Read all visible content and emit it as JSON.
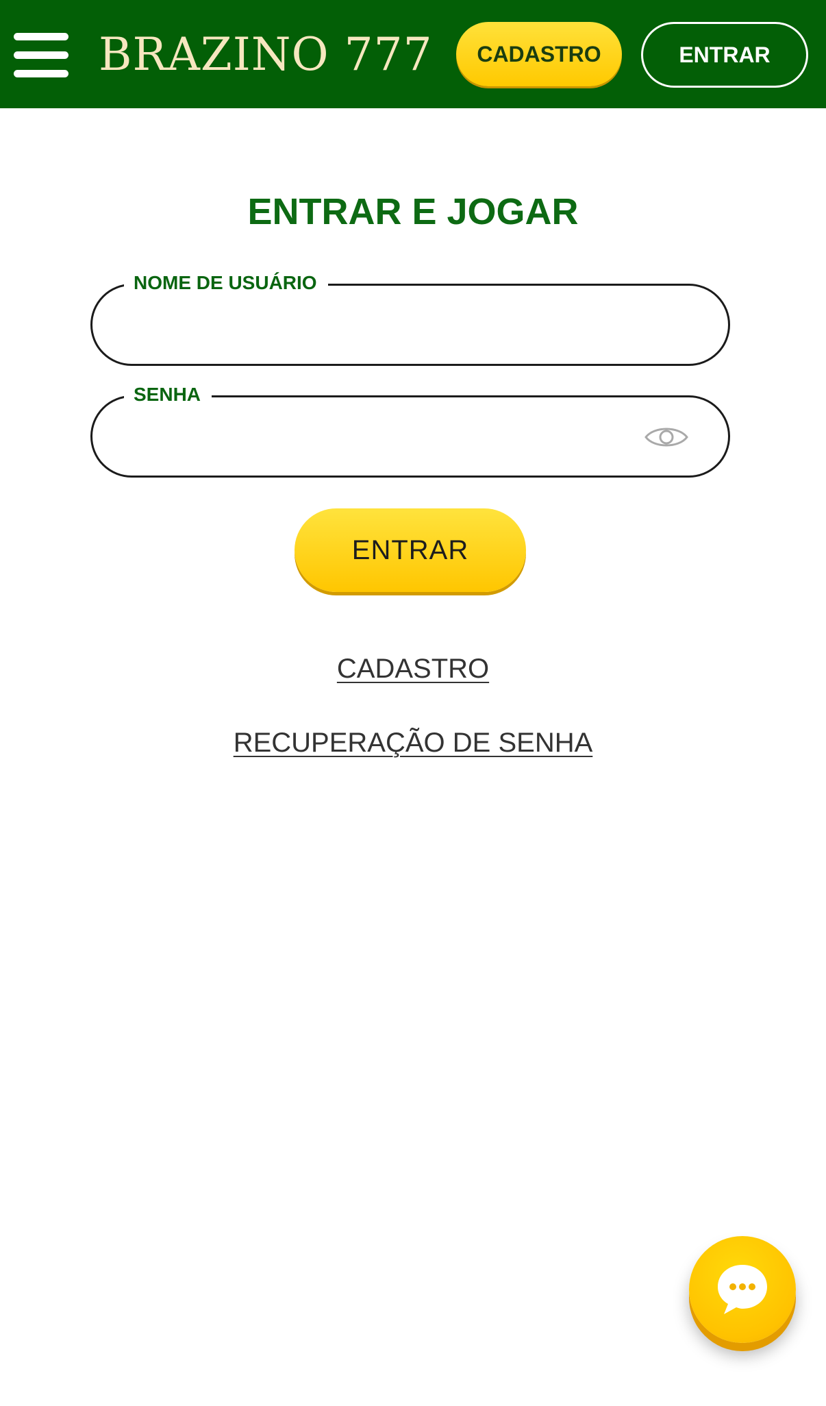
{
  "header": {
    "logo_text": "BRAZINO 777",
    "menu_icon": "hamburger-menu-icon",
    "cadastro_label": "CADASTRO",
    "entrar_label": "ENTRAR"
  },
  "login": {
    "title": "ENTRAR E JOGAR",
    "username": {
      "label": "NOME DE USUÁRIO",
      "value": ""
    },
    "password": {
      "label": "SENHA",
      "value": "",
      "toggle_icon": "eye-icon"
    },
    "submit_label": "ENTRAR",
    "register_link": "CADASTRO",
    "recovery_link": "RECUPERAÇÃO DE SENHA"
  },
  "chat": {
    "icon": "chat-bubble-icon"
  },
  "colors": {
    "header_bg": "#035f06",
    "accent_yellow": "#ffcc00",
    "title_green": "#0d6a13",
    "logo_cream": "#f6e7bf"
  }
}
